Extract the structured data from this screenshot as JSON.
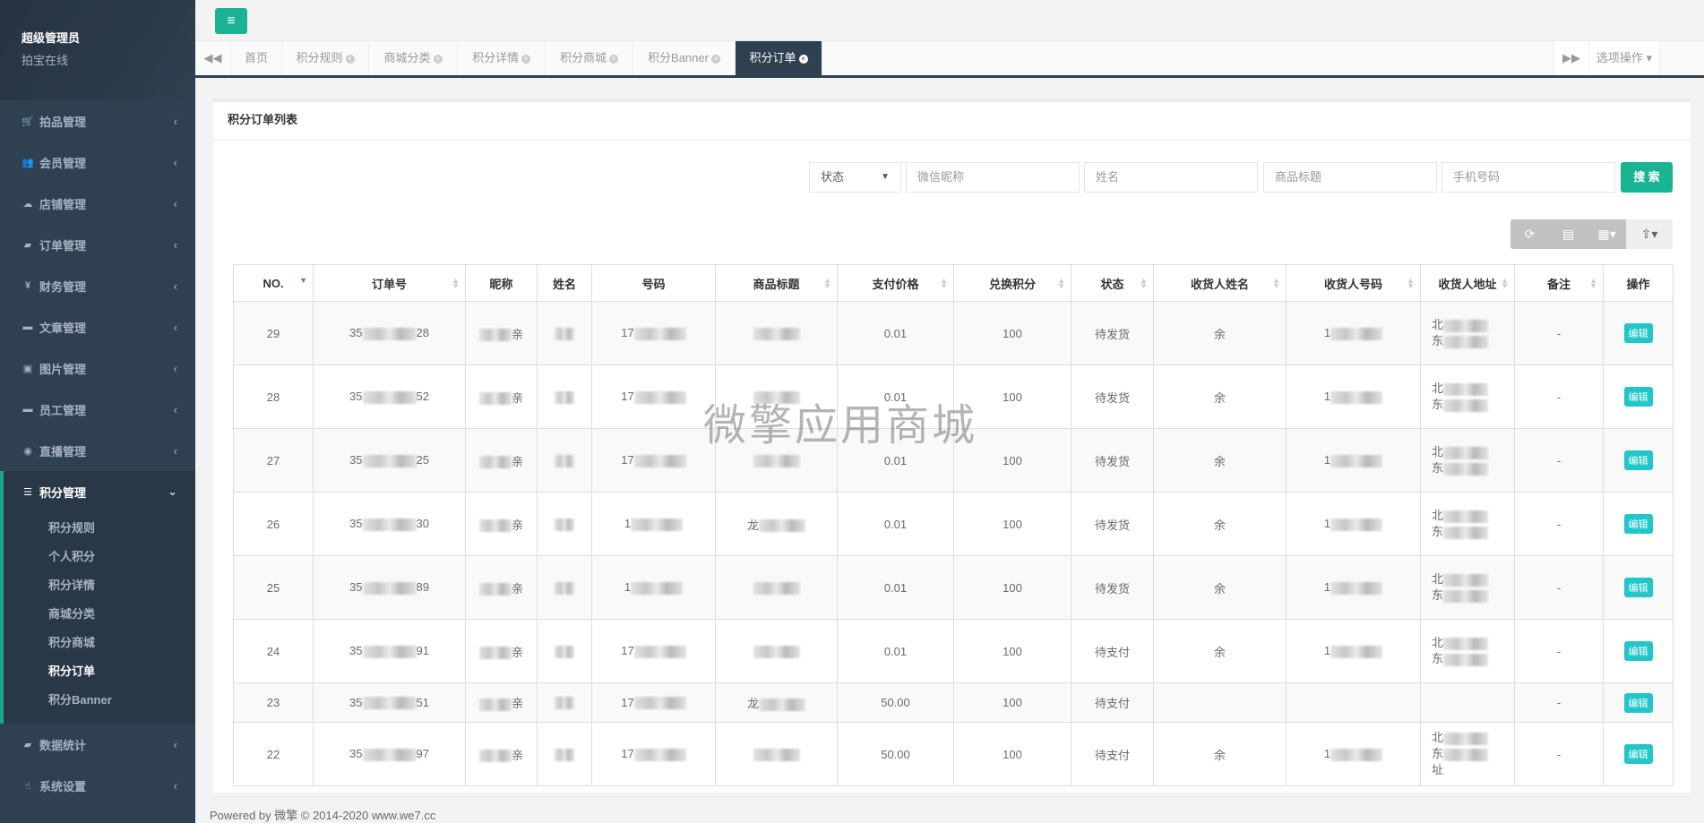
{
  "sidebar": {
    "user": "超级管理员",
    "subtitle": "拍宝在线",
    "items": [
      {
        "label": "拍品管理",
        "icon": "cart-icon",
        "g": "🛒"
      },
      {
        "label": "会员管理",
        "icon": "users-icon",
        "g": "👥"
      },
      {
        "label": "店铺管理",
        "icon": "cloud-icon",
        "g": "☁"
      },
      {
        "label": "订单管理",
        "icon": "book-icon",
        "g": "▰"
      },
      {
        "label": "财务管理",
        "icon": "yen-icon",
        "g": "¥"
      },
      {
        "label": "文章管理",
        "icon": "laptop-icon",
        "g": "▬"
      },
      {
        "label": "图片管理",
        "icon": "picture-icon",
        "g": "▣"
      },
      {
        "label": "员工管理",
        "icon": "laptop-icon",
        "g": "▬"
      },
      {
        "label": "直播管理",
        "icon": "eye-icon",
        "g": "◉"
      }
    ],
    "active": {
      "label": "积分管理",
      "icon": "database-icon",
      "sub": [
        "积分规则",
        "个人积分",
        "积分详情",
        "商城分类",
        "积分商城",
        "积分订单",
        "积分Banner"
      ],
      "current": "积分订单"
    },
    "after": [
      {
        "label": "数据统计",
        "icon": "book-icon",
        "g": "▰"
      },
      {
        "label": "系统设置",
        "icon": "hand-icon",
        "g": "☝"
      }
    ]
  },
  "tabs": {
    "items": [
      "首页",
      "积分规则",
      "商城分类",
      "积分详情",
      "积分商城",
      "积分Banner",
      "积分订单"
    ],
    "active": "积分订单",
    "options": "选项操作"
  },
  "panel": {
    "title": "积分订单列表"
  },
  "search": {
    "status": "状态",
    "wechat": "微信昵称",
    "name": "姓名",
    "title": "商品标题",
    "phone": "手机号码",
    "button": "搜 索"
  },
  "table": {
    "headers": [
      "NO.",
      "订单号",
      "昵称",
      "姓名",
      "号码",
      "商品标题",
      "支付价格",
      "兑换积分",
      "状态",
      "收货人姓名",
      "收货人号码",
      "收货人地址",
      "备注",
      "操作"
    ],
    "rows": [
      {
        "no": "29",
        "order": [
          "35",
          "28"
        ],
        "nick": "亲",
        "phone": "17",
        "title": "",
        "price": "0.01",
        "points": "100",
        "status": "待发货",
        "rname": "余",
        "rphone": "1",
        "addr": [
          "北",
          "东"
        ],
        "note": "-"
      },
      {
        "no": "28",
        "order": [
          "35",
          "52"
        ],
        "nick": "亲",
        "phone": "17",
        "title": "",
        "price": "0.01",
        "points": "100",
        "status": "待发货",
        "rname": "余",
        "rphone": "1",
        "addr": [
          "北",
          "东"
        ],
        "note": "-"
      },
      {
        "no": "27",
        "order": [
          "35",
          "25"
        ],
        "nick": "亲",
        "phone": "17",
        "title": "",
        "price": "0.01",
        "points": "100",
        "status": "待发货",
        "rname": "余",
        "rphone": "1",
        "addr": [
          "北",
          "东"
        ],
        "note": "-"
      },
      {
        "no": "26",
        "order": [
          "35",
          "30"
        ],
        "nick": "亲",
        "phone": "1",
        "title": "龙",
        "price": "0.01",
        "points": "100",
        "status": "待发货",
        "rname": "余",
        "rphone": "1",
        "addr": [
          "北",
          "东"
        ],
        "note": "-"
      },
      {
        "no": "25",
        "order": [
          "35",
          "89"
        ],
        "nick": "亲",
        "phone": "1",
        "title": "",
        "price": "0.01",
        "points": "100",
        "status": "待发货",
        "rname": "余",
        "rphone": "1",
        "addr": [
          "北",
          "东"
        ],
        "note": "-"
      },
      {
        "no": "24",
        "order": [
          "35",
          "91"
        ],
        "nick": "亲",
        "phone": "17",
        "title": "",
        "price": "0.01",
        "points": "100",
        "status": "待支付",
        "rname": "余",
        "rphone": "1",
        "addr": [
          "北",
          "东"
        ],
        "note": "-"
      },
      {
        "no": "23",
        "order": [
          "35",
          "51"
        ],
        "nick": "亲",
        "phone": "17",
        "title": "龙",
        "price": "50.00",
        "points": "100",
        "status": "待支付",
        "rname": "",
        "rphone": "",
        "addr": [],
        "note": "-",
        "short": true
      },
      {
        "no": "22",
        "order": [
          "35",
          "97"
        ],
        "nick": "亲",
        "phone": "17",
        "title": "",
        "price": "50.00",
        "points": "100",
        "status": "待支付",
        "rname": "余",
        "rphone": "1",
        "addr": [
          "北",
          "东",
          "址"
        ],
        "note": "-"
      }
    ],
    "edit": "编辑"
  },
  "watermark": "微擎应用商城",
  "footer": "Powered by 微擎 © 2014-2020 www.we7.cc",
  "colors": {
    "sidebar": "#2f4050",
    "primary": "#1ab394",
    "info": "#23c6c8"
  }
}
